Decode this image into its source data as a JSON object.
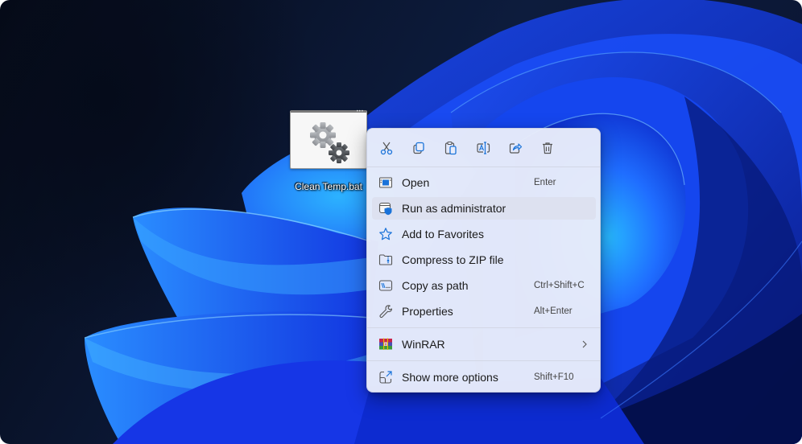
{
  "desktop": {
    "icon": {
      "label": "Clean Temp.bat",
      "icon_name": "batch-file-gears-icon"
    }
  },
  "context_menu": {
    "toolbar": [
      {
        "name": "cut",
        "icon": "scissors-icon",
        "tooltip": "Cut"
      },
      {
        "name": "copy",
        "icon": "copy-icon",
        "tooltip": "Copy"
      },
      {
        "name": "paste",
        "icon": "paste-icon",
        "tooltip": "Paste"
      },
      {
        "name": "rename",
        "icon": "rename-icon",
        "tooltip": "Rename"
      },
      {
        "name": "share",
        "icon": "share-icon",
        "tooltip": "Share"
      },
      {
        "name": "delete",
        "icon": "trash-icon",
        "tooltip": "Delete"
      }
    ],
    "items": [
      {
        "label": "Open",
        "shortcut": "Enter",
        "icon": "open-window-icon"
      },
      {
        "label": "Run as administrator",
        "shortcut": "",
        "icon": "admin-shield-icon",
        "highlighted": true
      },
      {
        "label": "Add to Favorites",
        "shortcut": "",
        "icon": "star-icon"
      },
      {
        "label": "Compress to ZIP file",
        "shortcut": "",
        "icon": "zip-folder-icon"
      },
      {
        "label": "Copy as path",
        "shortcut": "Ctrl+Shift+C",
        "icon": "copy-path-icon"
      },
      {
        "label": "Properties",
        "shortcut": "Alt+Enter",
        "icon": "wrench-icon"
      },
      {
        "label": "WinRAR",
        "shortcut": "",
        "icon": "winrar-icon",
        "submenu": true
      },
      {
        "label": "Show more options",
        "shortcut": "Shift+F10",
        "icon": "show-more-icon"
      }
    ]
  },
  "colors": {
    "accent": "#1a73d9",
    "menu_bg": "#e8ecfa",
    "hover_bg": "#dde1f0",
    "wallpaper_blue": "#1f5cff"
  }
}
